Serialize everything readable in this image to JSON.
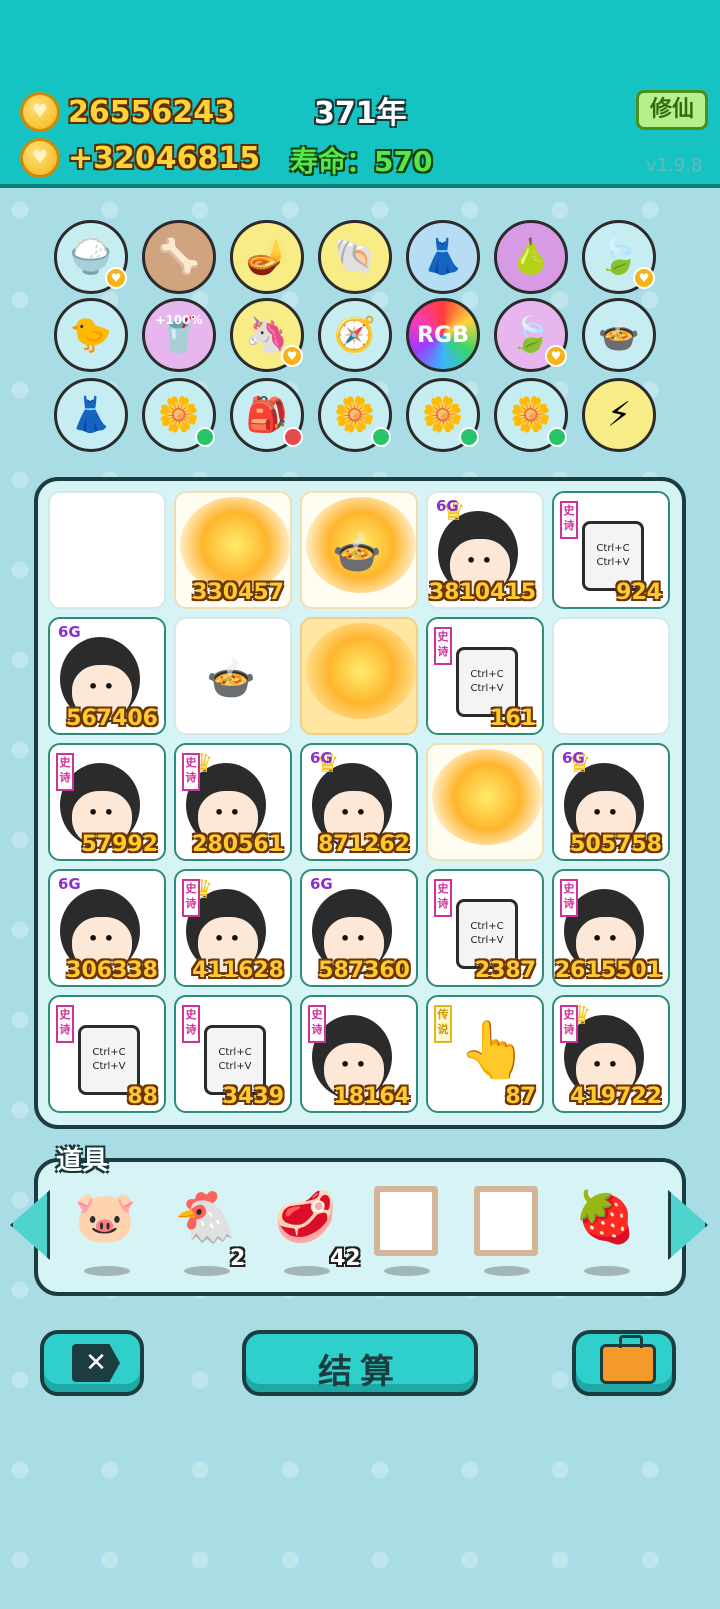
{
  "header": {
    "coins": "26556243",
    "income": "+32046815",
    "year": "371年",
    "lifespan_label": "寿命：",
    "lifespan_value": "570",
    "xiuxian_button": "修仙",
    "version": "v1.9.8"
  },
  "items": [
    [
      "rice-bowl-icon",
      "dog-food-icon",
      "magic-lamp-icon",
      "shell-icon",
      "skirt-icon",
      "pomelo-icon",
      "leaf-icon"
    ],
    [
      "chick-icon",
      "bubble-tea-icon",
      "unicorn-icon",
      "compass-icon",
      "rgb-icon",
      "leaf-icon",
      "pot-icon"
    ],
    [
      "skirt-icon",
      "flower-pot-icon",
      "seed-bag-icon",
      "flower-pot-icon",
      "flower-pot-icon",
      "flower-pot-icon",
      "lightning-icon"
    ]
  ],
  "rgb_label": "RGB",
  "pct_label": "+100%",
  "tags": {
    "epic": "史诗",
    "legend": "传说",
    "six_g": "6G",
    "clip_text": "Ctrl+C\nCtrl+V"
  },
  "board": [
    [
      "",
      "330457",
      "",
      "3810415",
      "924"
    ],
    [
      "567406",
      "",
      "",
      "161",
      ""
    ],
    [
      "57992",
      "280561",
      "871262",
      "",
      "505758"
    ],
    [
      "306338",
      "411628",
      "587360",
      "2387",
      "2615501"
    ],
    [
      "88",
      "3439",
      "18164",
      "87",
      "419722"
    ]
  ],
  "props": {
    "title": "道具",
    "items": [
      {
        "icon": "piggy-bank-icon",
        "count": ""
      },
      {
        "icon": "chicken-icon",
        "count": "2"
      },
      {
        "icon": "liver-icon",
        "count": "42"
      },
      {
        "icon": "picture-frame-icon",
        "count": ""
      },
      {
        "icon": "empty-frame-icon",
        "count": ""
      },
      {
        "icon": "strawberry-icon",
        "count": ""
      }
    ]
  },
  "buttons": {
    "close": "✕",
    "settle": "结算",
    "bag": "briefcase-icon"
  },
  "colors": {
    "header_bg": "#15c4c2",
    "page_bg": "#a9dde6",
    "coin_gold": "#ffd43b",
    "life_green": "#56e84a",
    "button_teal": "#2fd0cc"
  }
}
